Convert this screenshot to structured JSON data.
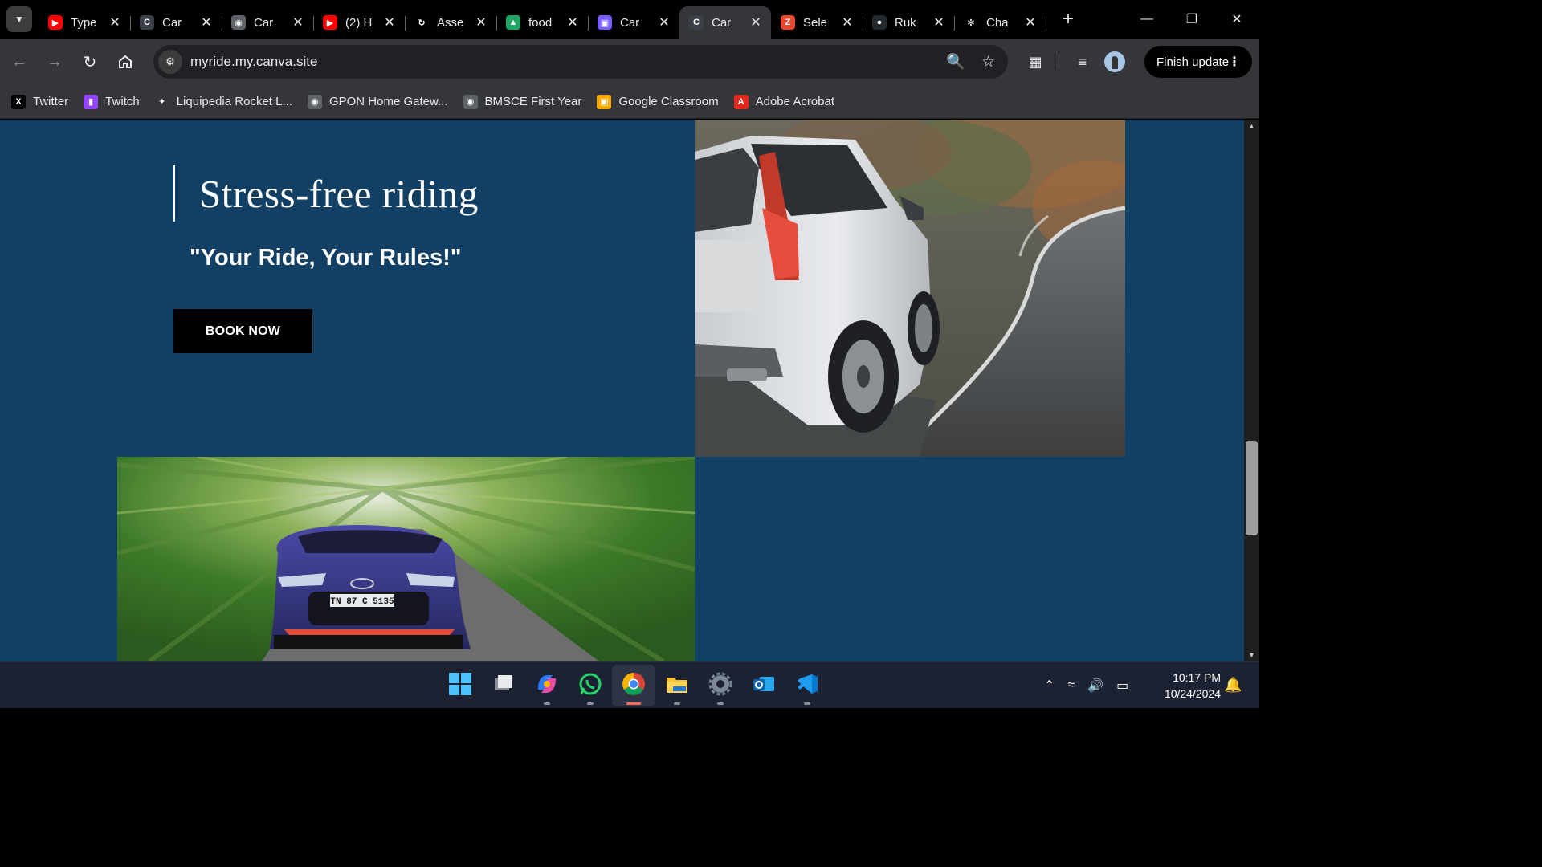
{
  "tabs": [
    {
      "title": "Type",
      "favicon": "youtube-icon",
      "active": false
    },
    {
      "title": "Car",
      "favicon": "canva-c-icon",
      "active": false
    },
    {
      "title": "Car",
      "favicon": "globe-icon",
      "active": false
    },
    {
      "title": "(2) H",
      "favicon": "youtube-icon",
      "active": false
    },
    {
      "title": "Asse",
      "favicon": "loading-icon",
      "active": false
    },
    {
      "title": "food",
      "favicon": "google-drive-icon",
      "active": false
    },
    {
      "title": "Car",
      "favicon": "calendar-app-icon",
      "active": false
    },
    {
      "title": "Car",
      "favicon": "canva-c-icon",
      "active": true
    },
    {
      "title": "Sele",
      "favicon": "zoho-icon",
      "active": false
    },
    {
      "title": "Ruk",
      "favicon": "github-icon",
      "active": false
    },
    {
      "title": "Cha",
      "favicon": "chatgpt-icon",
      "active": false
    }
  ],
  "toolbar": {
    "url": "myride.my.canva.site",
    "finish_update_label": "Finish update"
  },
  "bookmarks": [
    {
      "label": "Twitter",
      "icon": "x-twitter-icon"
    },
    {
      "label": "Twitch",
      "icon": "twitch-icon"
    },
    {
      "label": "Liquipedia Rocket L...",
      "icon": "liquipedia-icon"
    },
    {
      "label": "GPON Home Gatew...",
      "icon": "globe-icon"
    },
    {
      "label": "BMSCE First Year",
      "icon": "globe-icon"
    },
    {
      "label": "Google Classroom",
      "icon": "google-classroom-icon"
    },
    {
      "label": "Adobe Acrobat",
      "icon": "adobe-acrobat-icon"
    }
  ],
  "page": {
    "hero_title": "Stress-free riding",
    "tagline": "\"Your Ride, Your Rules!\"",
    "book_button": "BOOK NOW",
    "plate_text": "TN 87 C 5135",
    "background_color": "#123f64"
  },
  "taskbar": {
    "apps": [
      "windows-start-icon",
      "task-view-icon",
      "copilot-icon",
      "whatsapp-icon",
      "chrome-icon",
      "file-explorer-icon",
      "settings-icon",
      "outlook-icon",
      "vscode-icon"
    ],
    "time": "10:17 PM",
    "date": "10/24/2024"
  }
}
